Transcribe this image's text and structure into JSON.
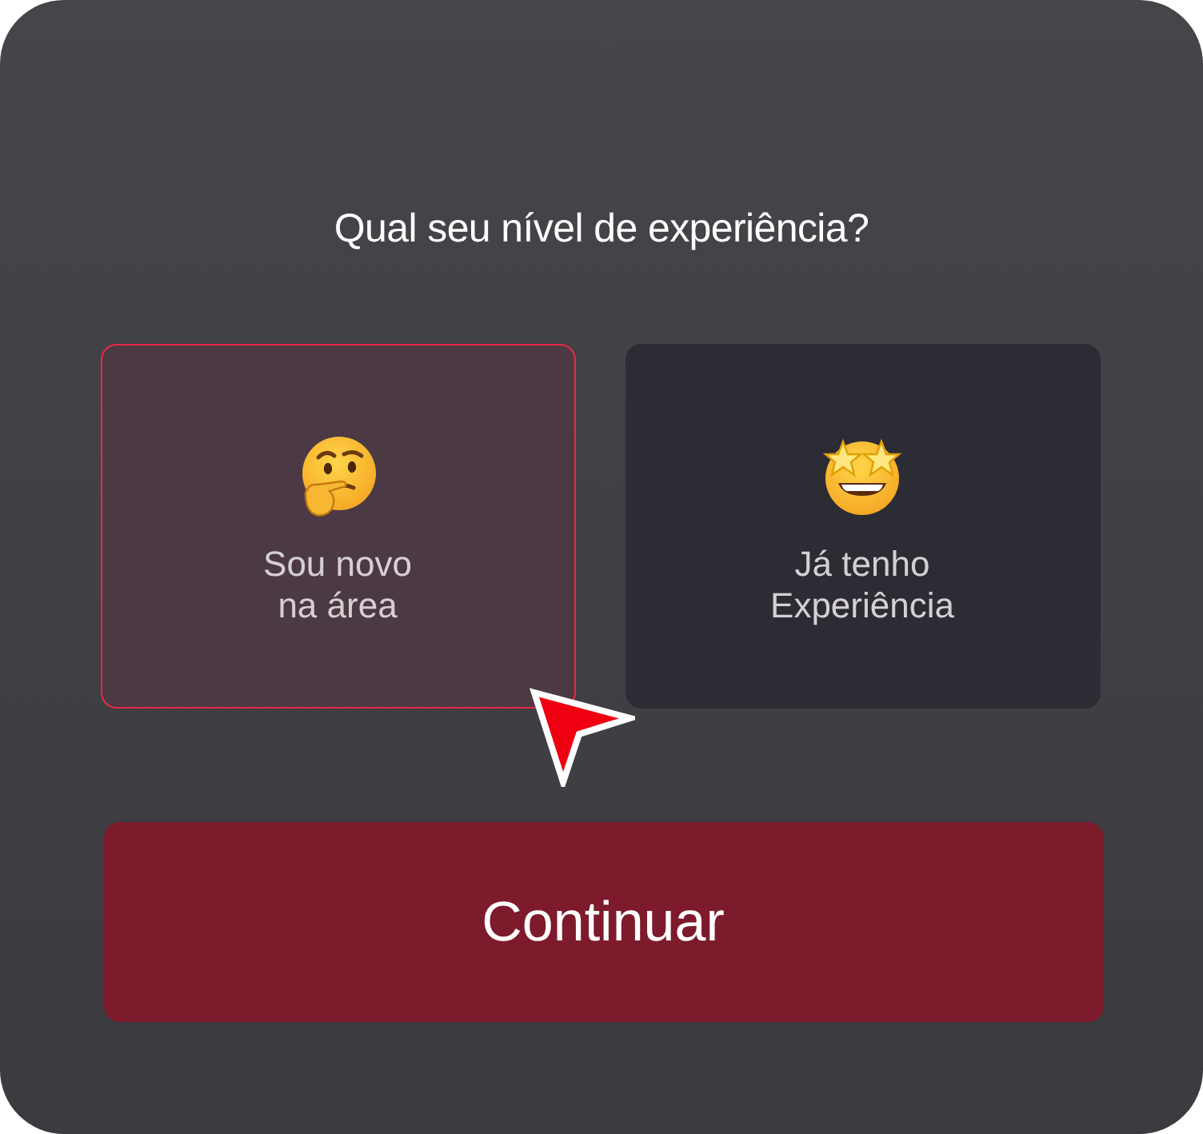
{
  "title": "Qual seu nível de experiência?",
  "options": [
    {
      "label": "Sou novo\nna área",
      "kind": "thinking",
      "selected": true
    },
    {
      "label": "Já tenho\nExperiência",
      "kind": "starstruck",
      "selected": false
    }
  ],
  "button": "Continuar"
}
